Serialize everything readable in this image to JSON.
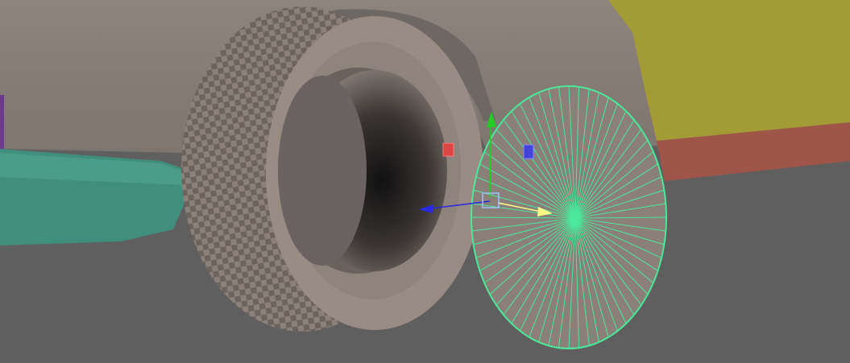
{
  "viewport": {
    "background": "#5f5f5f",
    "colors": {
      "car_body": "#8a817a",
      "car_body_shadow": "#6f6863",
      "yellow_panel": "#a39b36",
      "red_panel": "#a05549",
      "teal_panel": "#3f8f7c",
      "purple_panel": "#6a3a8c",
      "tire": "#968a82",
      "tire_dark": "#5a524e",
      "selection_wire": "#4be89a",
      "manip_x": "#2a2ae0",
      "manip_y": "#22cc22",
      "manip_z_pointer": "#ffff88",
      "handle_red": "#dd4444",
      "handle_blue": "#4444dd"
    },
    "objects": [
      {
        "name": "car-body",
        "icon": "mesh"
      },
      {
        "name": "tire",
        "icon": "mesh"
      },
      {
        "name": "wheel-disc-selected",
        "icon": "mesh",
        "selected": true,
        "spokes": 60
      }
    ],
    "manipulator": {
      "type": "move-tool",
      "axes": [
        "x",
        "y",
        "z"
      ]
    }
  }
}
